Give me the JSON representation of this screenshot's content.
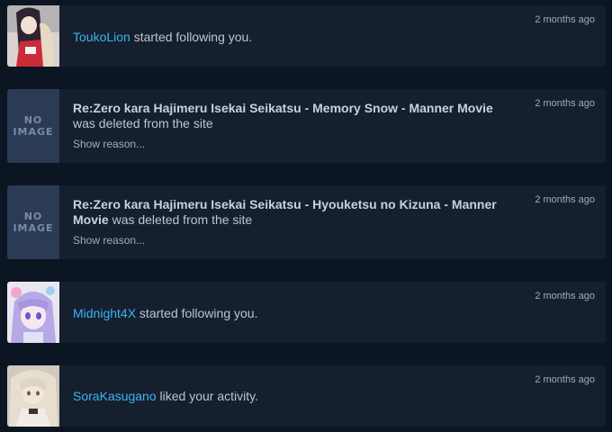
{
  "notifications": [
    {
      "type": "follow",
      "user": "ToukoLion",
      "message": " started following you.",
      "time": "2 months ago",
      "avatar": "anime-avatar-dark-hair-red-outfit"
    },
    {
      "type": "deleted",
      "no_image_line1": "NO",
      "no_image_line2": "IMAGE",
      "title": "Re:Zero kara Hajimeru Isekai Seikatsu - Memory Snow - Manner Movie",
      "message": " was deleted from the site",
      "reason_link": "Show reason...",
      "time": "2 months ago"
    },
    {
      "type": "deleted",
      "no_image_line1": "NO",
      "no_image_line2": "IMAGE",
      "title": "Re:Zero kara Hajimeru Isekai Seikatsu - Hyouketsu no Kizuna - Manner Movie",
      "message": " was deleted from the site",
      "reason_link": "Show reason...",
      "time": "2 months ago"
    },
    {
      "type": "follow",
      "user": "Midnight4X",
      "message": " started following you.",
      "time": "2 months ago",
      "avatar": "anime-avatar-purple-hair"
    },
    {
      "type": "like",
      "user": "SoraKasugano",
      "message": " liked your activity.",
      "time": "2 months ago",
      "avatar": "anime-avatar-light-hair"
    }
  ],
  "colors": {
    "background": "#0b1622",
    "card": "#151f2e",
    "link": "#3db4f2",
    "text": "#bcc6d2",
    "muted": "#9fadbd",
    "no_image_bg": "#2b3a55"
  }
}
